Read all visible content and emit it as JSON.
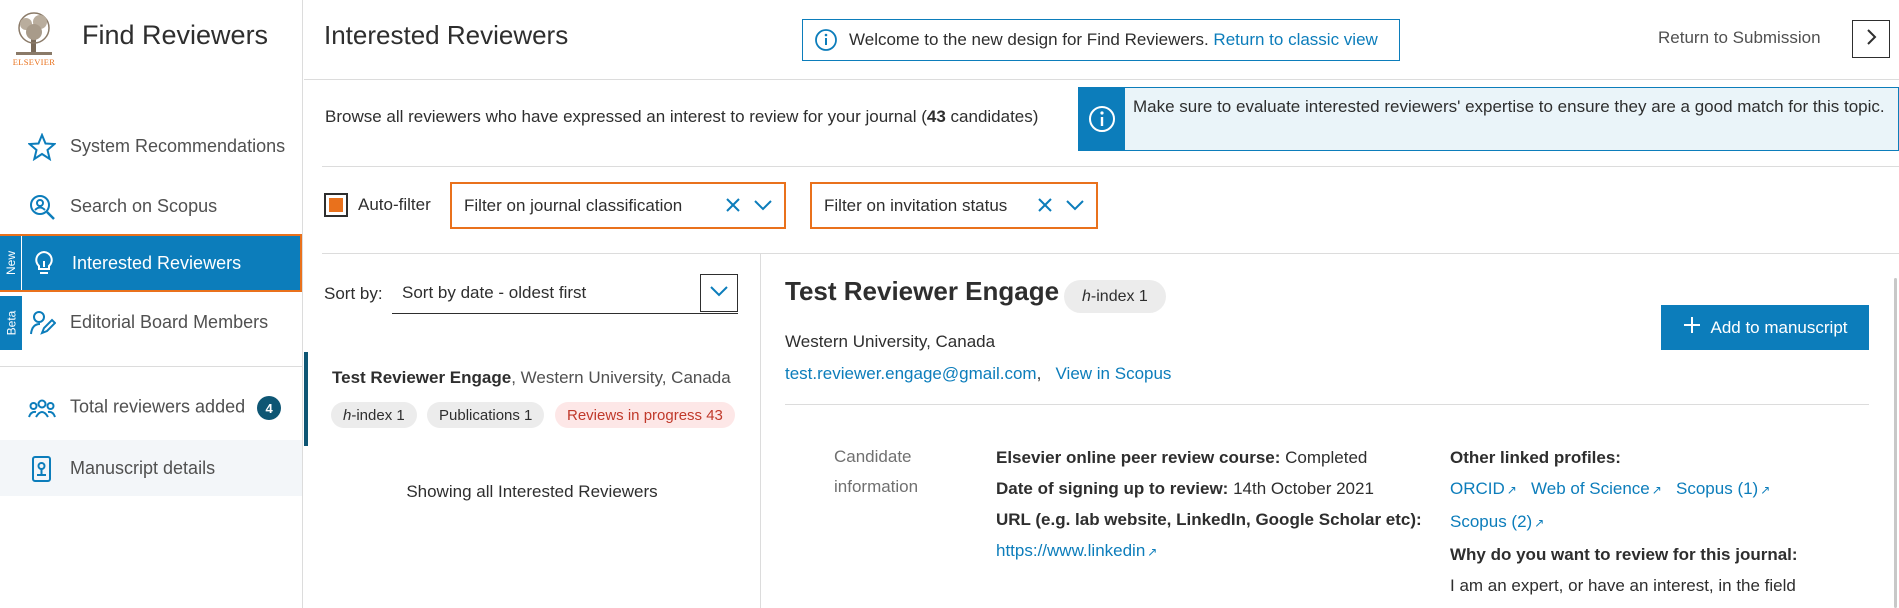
{
  "sidebar": {
    "logo_word": "ELSEVIER",
    "app_title": "Find Reviewers",
    "items": [
      {
        "label": "System Recommendations",
        "icon": "star-icon"
      },
      {
        "label": "Search on Scopus",
        "icon": "search-person-icon"
      },
      {
        "label": "Interested Reviewers",
        "icon": "lightbulb-icon",
        "tag": "New"
      },
      {
        "label": "Editorial Board Members",
        "icon": "person-edit-icon",
        "tag": "Beta"
      },
      {
        "label": "Total reviewers added",
        "icon": "people-icon",
        "count": "4"
      },
      {
        "label": "Manuscript details",
        "icon": "document-icon"
      }
    ]
  },
  "header": {
    "title": "Interested Reviewers",
    "welcome_text": "Welcome to the new design for Find Reviewers.",
    "classic_link": "Return to classic view",
    "return_text": "Return to Submission"
  },
  "intro": {
    "text_before": "Browse all reviewers who have expressed an interest to review for your journal (",
    "count": "43",
    "text_after": " candidates)",
    "notice": "Make sure to evaluate interested reviewers' expertise to ensure they are a good match for this topic."
  },
  "filters": {
    "autofilter_label": "Auto-filter",
    "journal": "Filter on journal classification",
    "invitation": "Filter on invitation status"
  },
  "list": {
    "sort_label": "Sort by:",
    "sort_value": "Sort by date - oldest first",
    "candidate": {
      "name": "Test Reviewer Engage",
      "affiliation": ", Western University, Canada",
      "hindex_prefix": "h",
      "hindex": "-index 1",
      "publications": "Publications 1",
      "reviews": "Reviews in progress 43"
    },
    "showing": "Showing all Interested Reviewers"
  },
  "detail": {
    "name": "Test Reviewer Engage",
    "hindex_prefix": "h",
    "hindex": "-index 1",
    "affiliation": "Western University, Canada",
    "email": "test.reviewer.engage@gmail.com",
    "scopus_link": "View in Scopus",
    "add_button": "Add to manuscript",
    "ci_label": "Candidate information",
    "course_label": "Elsevier online peer review course:",
    "course_value": "Completed",
    "date_label": "Date of signing up to review:",
    "date_value": "14th October 2021",
    "url_label": "URL (e.g. lab website, LinkedIn, Google Scholar etc):",
    "url_value": "https://www.linkedin",
    "linked_label": "Other linked profiles:",
    "linked": [
      "ORCID",
      "Web of Science",
      "Scopus (1)",
      "Scopus (2)"
    ],
    "why_label": "Why do you want to review for this journal:",
    "why_value": "I am an expert, or have an interest, in the field"
  },
  "colors": {
    "primary": "#0c7dbb",
    "accent": "#e9711c",
    "badge": "#0e5674",
    "review_red": "#c0392b"
  }
}
